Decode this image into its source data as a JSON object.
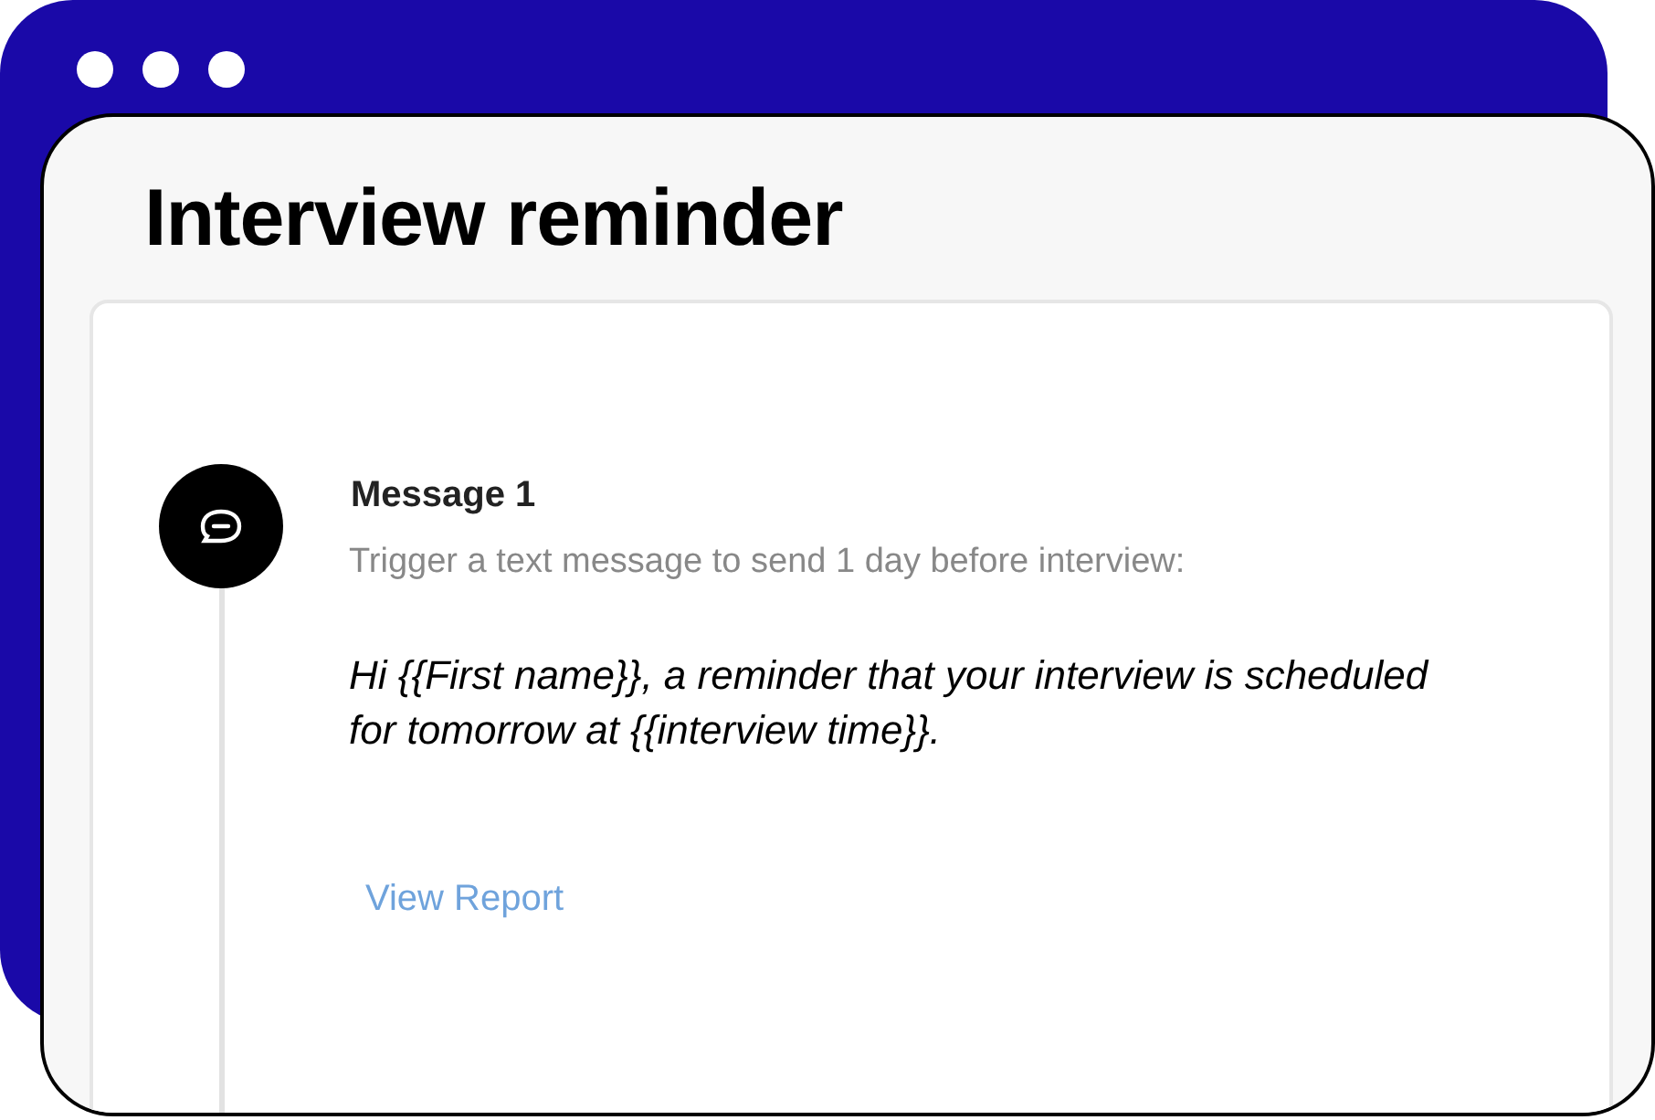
{
  "window": {
    "title": "Interview reminder"
  },
  "message": {
    "title": "Message 1",
    "subtitle": "Trigger a text message to send 1 day before interview:",
    "body": "Hi {{First name}}, a reminder that your interview is scheduled for tomorrow at {{interview time}}.",
    "link": "View Report"
  }
}
